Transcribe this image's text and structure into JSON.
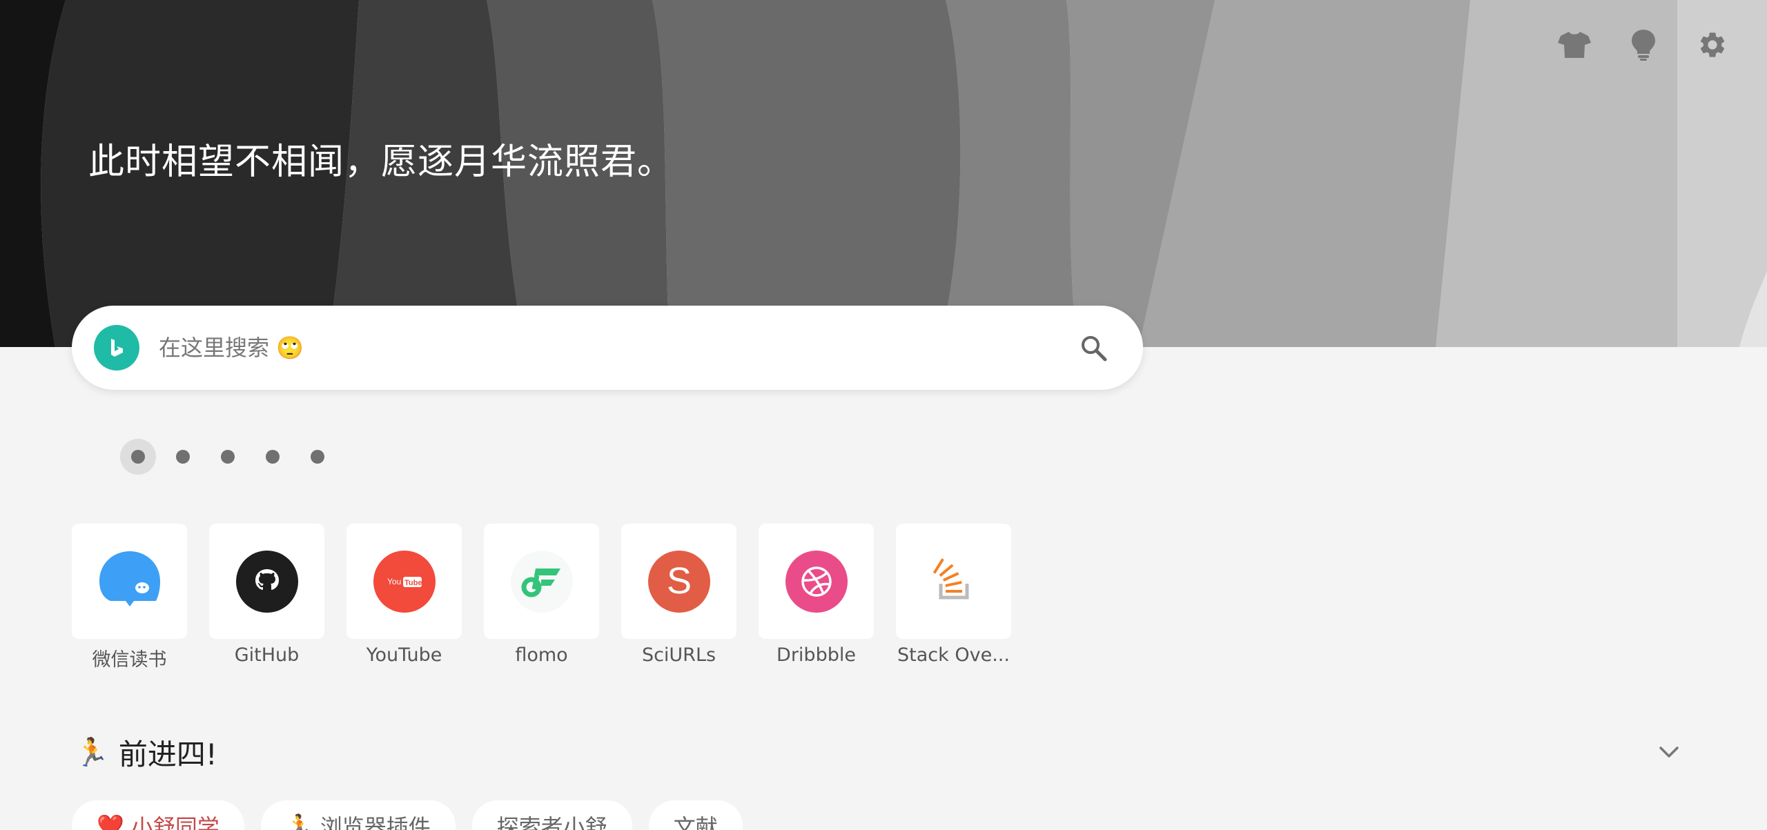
{
  "banner": {
    "quote": "此时相望不相闻，愿逐月华流照君。"
  },
  "top_actions": [
    {
      "name": "theme",
      "icon": "shirt-icon"
    },
    {
      "name": "tips",
      "icon": "lightbulb-icon"
    },
    {
      "name": "settings",
      "icon": "gear-icon"
    }
  ],
  "search": {
    "engine_icon": "bing-icon",
    "engine_color": "#1fbba6",
    "placeholder": "在这里搜索 🙄"
  },
  "pages": {
    "count": 5,
    "active_index": 0
  },
  "tiles": [
    {
      "label": "微信读书",
      "icon": "weread-icon",
      "color": "#3d9ff5"
    },
    {
      "label": "GitHub",
      "icon": "github-icon",
      "color": "#1e1e1e"
    },
    {
      "label": "YouTube",
      "icon": "youtube-icon",
      "color": "#f24a3b",
      "icon_text": "You Tube"
    },
    {
      "label": "flomo",
      "icon": "flomo-icon",
      "color": "#33c47a"
    },
    {
      "label": "SciURLs",
      "icon": "sciurls-icon",
      "color": "#e25d45",
      "icon_text": "S"
    },
    {
      "label": "Dribbble",
      "icon": "dribbble-icon",
      "color": "#ea4c89"
    },
    {
      "label": "Stack Ove...",
      "icon": "stackoverflow-icon",
      "color": "#f48024"
    }
  ],
  "section": {
    "title": "前进四!",
    "icon": "running-emoji",
    "emoji": "🏃"
  },
  "chips": [
    {
      "label": "小舒同学",
      "icon": "heart-icon",
      "emoji": "❤️",
      "active": true
    },
    {
      "label": "浏览器插件",
      "icon": "person-icon",
      "emoji": "🏃",
      "active": false
    },
    {
      "label": "探索者小舒",
      "active": false
    },
    {
      "label": "文献",
      "active": false
    }
  ]
}
